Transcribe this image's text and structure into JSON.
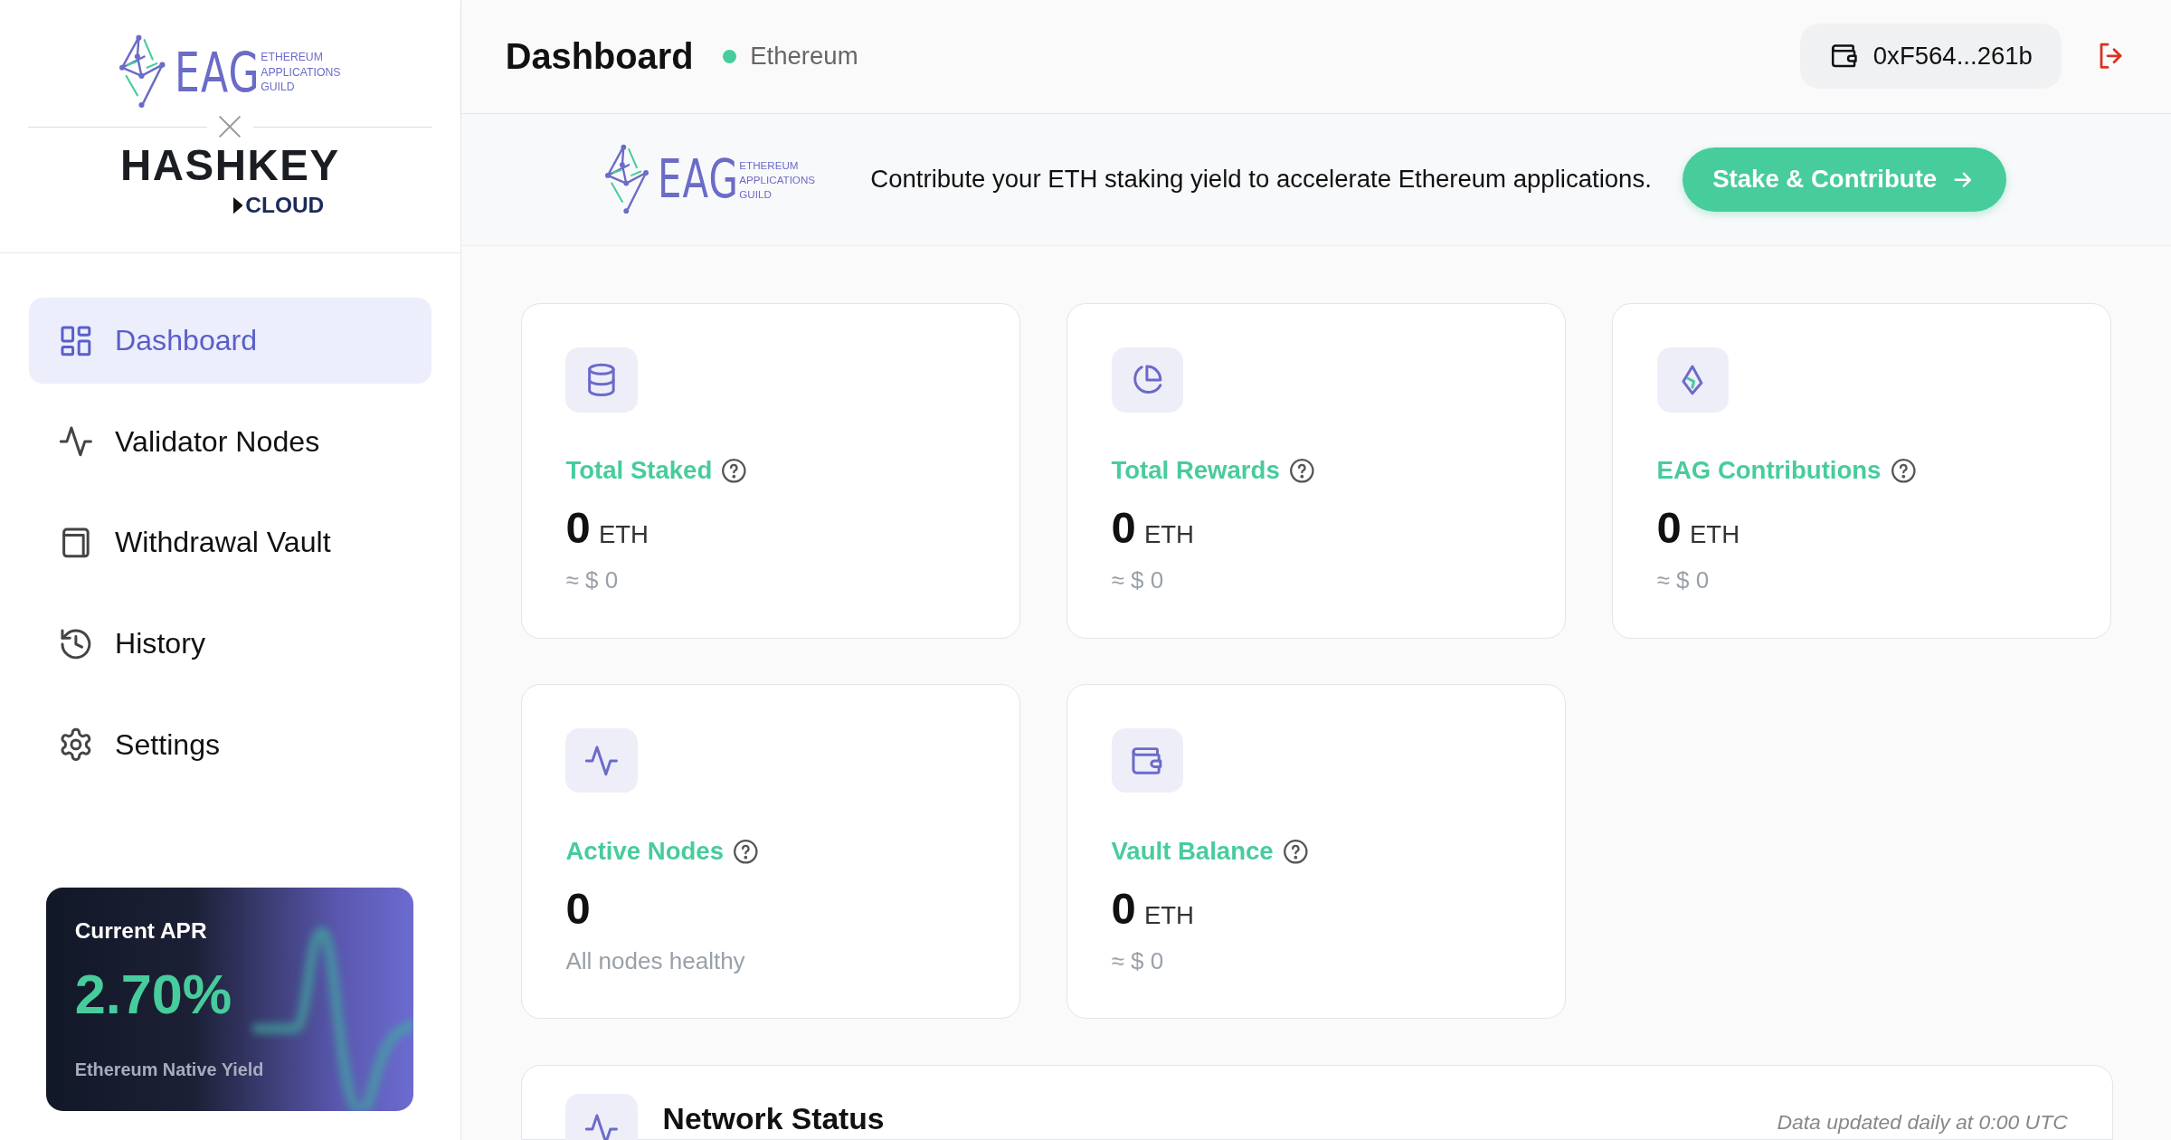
{
  "sidebar": {
    "brand": {
      "name": "EAG",
      "tagline": [
        "ETHEREUM",
        "APPLICATIONS",
        "GUILD"
      ]
    },
    "partner": {
      "name": "HASHKEY",
      "sub": "CLOUD"
    },
    "nav": [
      {
        "label": "Dashboard",
        "selected": true
      },
      {
        "label": "Validator Nodes",
        "selected": false
      },
      {
        "label": "Withdrawal Vault",
        "selected": false
      },
      {
        "label": "History",
        "selected": false
      },
      {
        "label": "Settings",
        "selected": false
      }
    ],
    "apr": {
      "title": "Current APR",
      "value": "2.70%",
      "caption": "Ethereum Native Yield"
    }
  },
  "header": {
    "title": "Dashboard",
    "network": "Ethereum",
    "wallet": "0xF564...261b"
  },
  "banner": {
    "brand": {
      "name": "EAG",
      "tagline": [
        "ETHEREUM",
        "APPLICATIONS",
        "GUILD"
      ]
    },
    "text": "Contribute your ETH staking yield to accelerate Ethereum applications.",
    "button": "Stake & Contribute"
  },
  "stats": [
    {
      "label": "Total Staked",
      "value": "0",
      "unit": "ETH",
      "note": "≈ $ 0"
    },
    {
      "label": "Total Rewards",
      "value": "0",
      "unit": "ETH",
      "note": "≈ $ 0"
    },
    {
      "label": "EAG Contributions",
      "value": "0",
      "unit": "ETH",
      "note": "≈ $ 0"
    },
    {
      "label": "Active Nodes",
      "value": "0",
      "note": "All nodes healthy"
    },
    {
      "label": "Vault Balance",
      "value": "0",
      "unit": "ETH",
      "note": "≈ $ 0"
    }
  ],
  "network_status": {
    "title": "Network Status",
    "note": "Data updated daily at 0:00 UTC"
  }
}
